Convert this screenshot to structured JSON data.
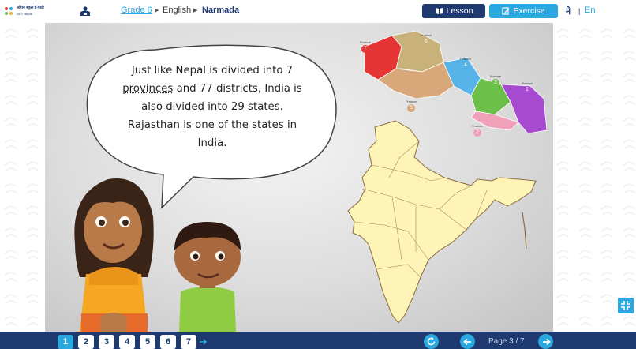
{
  "header": {
    "logo_title": "ओपन स्कूल ई-पाटी",
    "logo_subtitle": "OLE Nepal",
    "breadcrumb": {
      "grade": "Grade 6",
      "subject": "English",
      "lesson": "Narmada"
    },
    "lesson_button": "Lesson",
    "exercise_button": "Exercise",
    "lang_ne": "ने",
    "lang_sep": "|",
    "lang_en": "En"
  },
  "slide": {
    "speech_lines": [
      "Just like Nepal is divided into 7",
      "provinces",
      " and 77 districts, India is",
      "also divided into 29 states.",
      "Rajasthan is one of the states in",
      "India."
    ],
    "nepal_map": {
      "provinces": [
        {
          "label": "Province",
          "number": "7",
          "color": "#e63535"
        },
        {
          "label": "Province",
          "number": "6",
          "color": "#c9b27a"
        },
        {
          "label": "Province",
          "number": "5",
          "color": "#d9a87a"
        },
        {
          "label": "Province",
          "number": "4",
          "color": "#58b4e8"
        },
        {
          "label": "Province",
          "number": "3",
          "color": "#6cc04a"
        },
        {
          "label": "Province",
          "number": "2",
          "color": "#f0a0b8"
        },
        {
          "label": "Province",
          "number": "1",
          "color": "#a64bd0"
        }
      ]
    },
    "india_map_color": "#fff4b8"
  },
  "footer": {
    "pages": [
      "1",
      "2",
      "3",
      "4",
      "5",
      "6",
      "7"
    ],
    "active_page": "1",
    "page_info": "Page 3 / 7"
  },
  "colors": {
    "accent_dark": "#1f3a70",
    "accent_light": "#2aa8e0"
  }
}
